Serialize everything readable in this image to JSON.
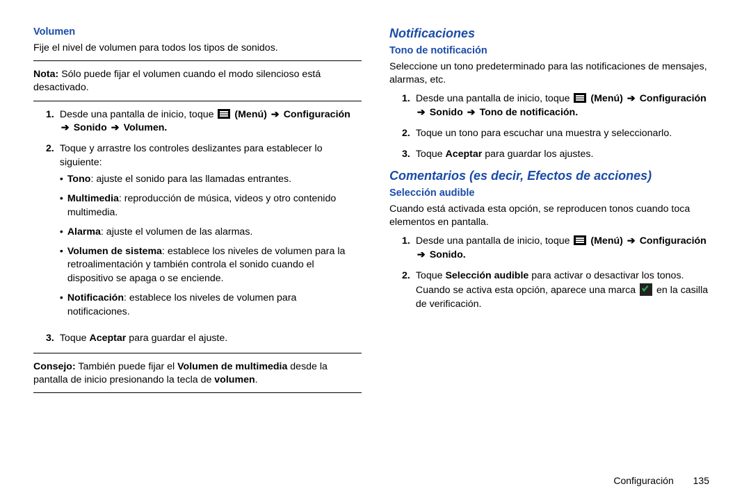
{
  "left": {
    "h_volumen": "Volumen",
    "intro": "Fije el nivel de volumen para todos los tipos de sonidos.",
    "nota_label": "Nota:",
    "nota_text": " Sólo puede fijar el volumen cuando el modo silencioso está desactivado.",
    "step1_pre": "Desde una pantalla de inicio, toque ",
    "step1_menu": "(Menú)",
    "step1_b2": "Configuración",
    "step1_b3": "Sonido",
    "step1_b4": "Volumen",
    "step2": "Toque y arrastre los controles deslizantes para establecer lo siguiente:",
    "bullets": {
      "b1_b": "Tono",
      "b1_t": ": ajuste el sonido para las llamadas entrantes.",
      "b2_b": "Multimedia",
      "b2_t": ": reproducción de música, videos y otro contenido multimedia.",
      "b3_b": "Alarma",
      "b3_t": ": ajuste el volumen de las alarmas.",
      "b4_b": "Volumen de sistema",
      "b4_t": ": establece los niveles de volumen para la retroalimentación y también controla el sonido cuando el dispositivo se apaga o se enciende.",
      "b5_b": "Notificación",
      "b5_t": ": establece los niveles de volumen para notificaciones."
    },
    "step3_pre": "Toque ",
    "step3_b": "Aceptar",
    "step3_post": " para guardar el ajuste.",
    "consejo_label": "Consejo:",
    "consejo_t1": " También puede fijar el ",
    "consejo_b1": "Volumen de multimedia",
    "consejo_t2": " desde la pantalla de inicio presionando la tecla de ",
    "consejo_b2": "volumen",
    "consejo_t3": "."
  },
  "right": {
    "h_notif": "Notificaciones",
    "h_tono": "Tono de notificación",
    "tono_intro": "Seleccione un tono predeterminado para las notificaciones de mensajes, alarmas, etc.",
    "t_step1_pre": "Desde una pantalla de inicio, toque ",
    "t_step1_menu": "(Menú)",
    "t_step1_b2": "Configuración",
    "t_step1_b3": "Sonido",
    "t_step1_b4": "Tono de notificación",
    "t_step2": "Toque un tono para escuchar una muestra y seleccionarlo.",
    "t_step3_pre": "Toque ",
    "t_step3_b": "Aceptar",
    "t_step3_post": " para guardar los ajustes.",
    "h_coment": "Comentarios (es decir, Efectos de acciones)",
    "h_sel": "Selección audible",
    "sel_intro": "Cuando está activada esta opción, se reproducen tonos cuando toca elementos en pantalla.",
    "s_step1_pre": "Desde una pantalla de inicio, toque ",
    "s_step1_menu": "(Menú)",
    "s_step1_b2": "Configuración",
    "s_step1_b3": "Sonido",
    "s_step2_pre": "Toque ",
    "s_step2_b": "Selección audible",
    "s_step2_mid": " para activar o desactivar los tonos. Cuando se activa esta opción, aparece una marca ",
    "s_step2_post": " en la casilla de verificación."
  },
  "footer": {
    "section": "Configuración",
    "page": "135"
  }
}
